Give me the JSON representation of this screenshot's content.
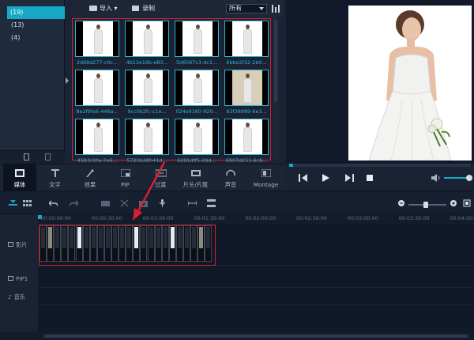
{
  "folders": [
    {
      "label": "(19)",
      "selected": true
    },
    {
      "label": "(13)",
      "selected": false
    },
    {
      "label": "(4)",
      "selected": false
    }
  ],
  "library_toolbar": {
    "import_label": "导入",
    "record_label": "录制",
    "filter_value": "所有"
  },
  "thumbnails": [
    {
      "name": "2d68d277-c0c...",
      "style": "plain"
    },
    {
      "name": "4b13e16b-e83...",
      "style": "plain"
    },
    {
      "name": "5d6067c3-dc1...",
      "style": "plain"
    },
    {
      "name": "6bbe2f32-2b0...",
      "style": "plain"
    },
    {
      "name": "8e2f9fa6-446a...",
      "style": "plain"
    },
    {
      "name": "9cc0b2fc-c1e...",
      "style": "plain"
    },
    {
      "name": "024e9160-920...",
      "style": "plain"
    },
    {
      "name": "93f38989-6e3...",
      "style": "sepia"
    },
    {
      "name": "4583c0fa-7e6...",
      "style": "plain"
    },
    {
      "name": "5720b28f-41d...",
      "style": "plain"
    },
    {
      "name": "6291dff5-29d...",
      "style": "plain"
    },
    {
      "name": "6907d251-6c8...",
      "style": "plain"
    }
  ],
  "tabs": [
    {
      "label": "媒体",
      "icon": "film-strip-icon",
      "active": true
    },
    {
      "label": "文字",
      "icon": "text-t-icon",
      "active": false
    },
    {
      "label": "效果",
      "icon": "magic-wand-icon",
      "active": false
    },
    {
      "label": "PIP",
      "icon": "pip-icon",
      "active": false
    },
    {
      "label": "过渡",
      "icon": "transition-icon",
      "active": false
    },
    {
      "label": "片头/片尾",
      "icon": "title-clip-icon",
      "active": false
    },
    {
      "label": "声音",
      "icon": "headphones-icon",
      "active": false
    },
    {
      "label": "Montage",
      "icon": "montage-icon",
      "active": false
    }
  ],
  "playback": {
    "progress": 0.02,
    "volume": 0.9
  },
  "timeline": {
    "ruler_labels": [
      "00:00:00:00",
      "00:00:30:00",
      "00:01:00:00",
      "00:01:30:00",
      "00:02:00:00",
      "00:02:30:00",
      "00:03:00:00",
      "00:03:30:00",
      "00:04:00:00"
    ],
    "track_labels": [
      "影片",
      "PIP1",
      "音乐"
    ],
    "zoom": 0.45,
    "clip_frames": [
      "dark",
      "mid",
      "dark",
      "dark",
      "dark",
      "bright",
      "dark",
      "dark",
      "dark",
      "dark",
      "dark",
      "dark",
      "dark",
      "bright",
      "dark",
      "dark",
      "dark",
      "dark",
      "bright",
      "dark",
      "dark",
      "dark",
      "mid",
      "dark"
    ]
  },
  "colors": {
    "accent": "#17a8c8",
    "highlight": "#d6222a"
  }
}
